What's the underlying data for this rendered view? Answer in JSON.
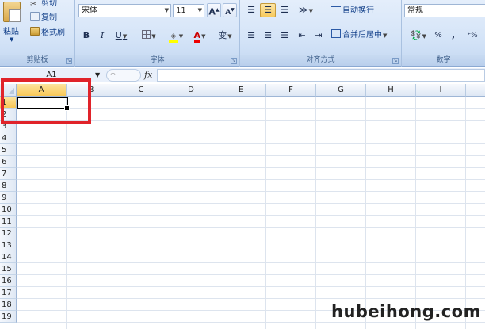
{
  "clipboard": {
    "paste_label": "粘贴",
    "cut_label": "剪切",
    "copy_label": "复制",
    "format_painter_label": "格式刷",
    "group_title": "剪贴板"
  },
  "font": {
    "font_name": "宋体",
    "font_size": "11",
    "grow_label": "A",
    "shrink_label": "A",
    "bold_label": "B",
    "italic_label": "I",
    "underline_label": "U",
    "font_color_label": "A",
    "pinyin_label": "变",
    "group_title": "字体"
  },
  "alignment": {
    "wrap_label": "自动换行",
    "merge_label": "合并后居中",
    "group_title": "对齐方式"
  },
  "number": {
    "format": "常规",
    "percent_label": "%",
    "comma_label": ",",
    "group_title": "数字"
  },
  "formula_bar": {
    "name_box": "A1",
    "fx_label": "fx",
    "value": ""
  },
  "grid": {
    "columns": [
      "A",
      "B",
      "C",
      "D",
      "E",
      "F",
      "G",
      "H",
      "I"
    ],
    "rows": [
      "1",
      "2",
      "3",
      "4",
      "5",
      "6",
      "7",
      "8",
      "9",
      "10",
      "11",
      "12",
      "13",
      "14",
      "15",
      "16",
      "17",
      "18",
      "19"
    ],
    "active_cell": "A1"
  },
  "watermark": "hubeihong.com",
  "colors": {
    "highlight_box": "#e0232a",
    "selected_header": "#f8c756",
    "ribbon": "#d6e5f8"
  }
}
